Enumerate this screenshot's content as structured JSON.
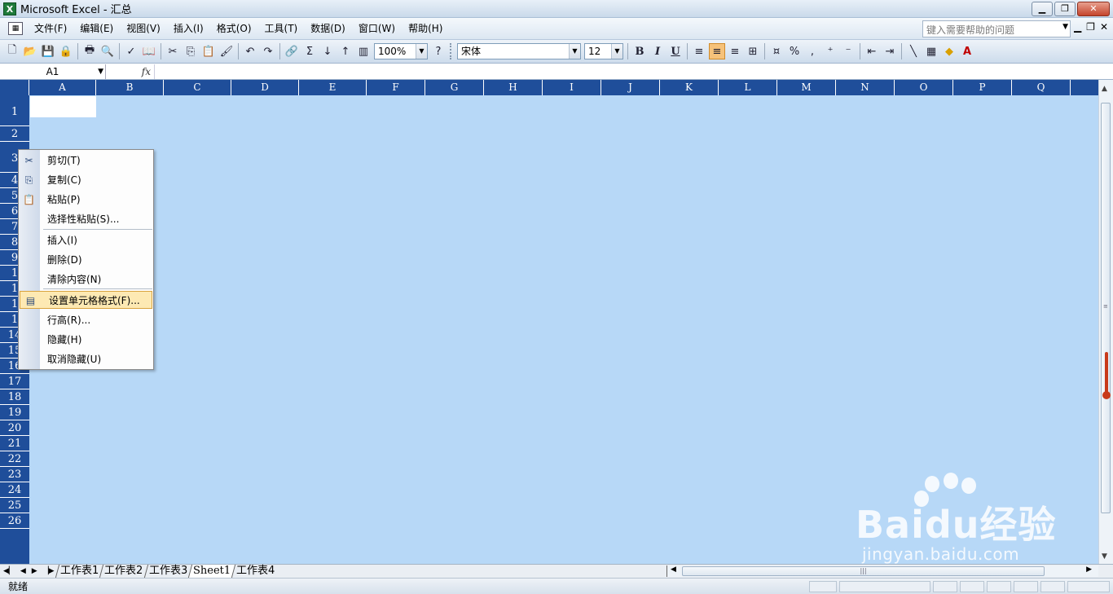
{
  "window": {
    "title": "Microsoft Excel - 汇总",
    "app_icon": "X"
  },
  "menubar": {
    "items": [
      "文件(F)",
      "编辑(E)",
      "视图(V)",
      "插入(I)",
      "格式(O)",
      "工具(T)",
      "数据(D)",
      "窗口(W)",
      "帮助(H)"
    ],
    "help_placeholder": "键入需要帮助的问题"
  },
  "toolbar": {
    "zoom": "100%",
    "font_name": "宋体",
    "font_size": "12",
    "bold": "B",
    "italic": "I",
    "underline": "U",
    "percent": "%",
    "comma": ","
  },
  "formula_bar": {
    "name_box": "A1",
    "fx": "fx"
  },
  "grid": {
    "columns": [
      "A",
      "B",
      "C",
      "D",
      "E",
      "F",
      "G",
      "H",
      "I",
      "J",
      "K",
      "L",
      "M",
      "N",
      "O",
      "P",
      "Q"
    ],
    "rows": [
      "1",
      "2",
      "3",
      "4",
      "5",
      "6",
      "7",
      "8",
      "9",
      "1",
      "1",
      "1",
      "1",
      "14",
      "15",
      "16",
      "17",
      "18",
      "19",
      "20",
      "21",
      "22",
      "23",
      "24",
      "25",
      "26"
    ]
  },
  "context_menu": {
    "items": [
      {
        "label": "剪切(T)",
        "icon": "scissors-icon"
      },
      {
        "label": "复制(C)",
        "icon": "copy-icon"
      },
      {
        "label": "粘贴(P)",
        "icon": "paste-icon"
      },
      {
        "label": "选择性粘贴(S)...",
        "icon": ""
      },
      {
        "label": "插入(I)",
        "icon": ""
      },
      {
        "label": "删除(D)",
        "icon": ""
      },
      {
        "label": "清除内容(N)",
        "icon": ""
      },
      {
        "label": "设置单元格格式(F)...",
        "icon": "format-cells-icon"
      },
      {
        "label": "行高(R)...",
        "icon": ""
      },
      {
        "label": "隐藏(H)",
        "icon": ""
      },
      {
        "label": "取消隐藏(U)",
        "icon": ""
      }
    ],
    "highlighted_index": 7
  },
  "sheet_tabs": {
    "tabs": [
      "工作表1",
      "工作表2",
      "工作表3",
      "Sheet1",
      "工作表4"
    ],
    "active_index": 3
  },
  "statusbar": {
    "text": "就绪"
  },
  "watermark": {
    "brand": "Baidu经验",
    "url": "jingyan.baidu.com"
  }
}
